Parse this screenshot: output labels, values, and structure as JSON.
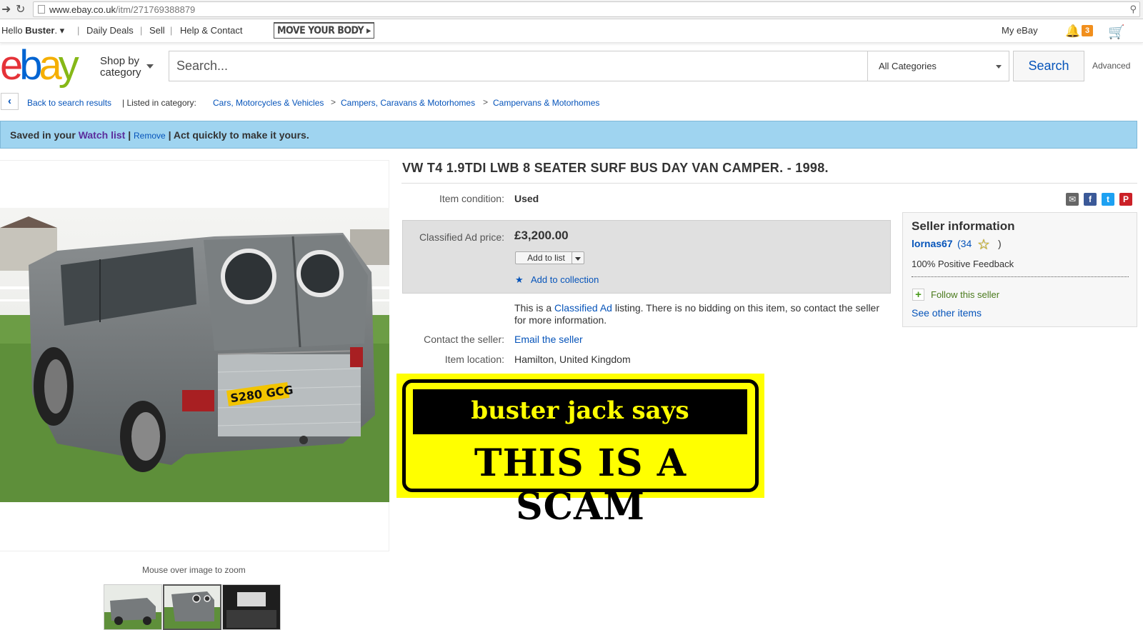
{
  "browser": {
    "url_host": "www.ebay.co.uk",
    "url_path": "/itm/271769388879"
  },
  "topnav": {
    "hello": "Hello",
    "user": "Buster",
    "daily_deals": "Daily Deals",
    "sell": "Sell",
    "help": "Help & Contact",
    "promo": "MOVE YOUR BODY ▸",
    "my_ebay": "My eBay",
    "notifications": "3"
  },
  "header": {
    "shop_by": "Shop by",
    "category": "category",
    "search_placeholder": "Search...",
    "category_select": "All Categories",
    "search_button": "Search",
    "advanced": "Advanced"
  },
  "breadcrumb": {
    "back": "Back to search results",
    "listed_in": "| Listed in category:",
    "items": [
      "Cars, Motorcycles & Vehicles",
      "Campers, Caravans & Motorhomes",
      "Campervans & Motorhomes"
    ],
    "sep": ">"
  },
  "saved_banner": {
    "saved_in": "Saved in your",
    "watch_list": "Watch list",
    "remove": "Remove",
    "act": "| Act quickly to make it yours."
  },
  "listing": {
    "title": "VW T4 1.9TDI LWB 8 SEATER SURF BUS DAY VAN CAMPER. - 1998.",
    "condition_label": "Item condition:",
    "condition": "Used",
    "price_label": "Classified Ad price:",
    "price": "£3,200.00",
    "add_to_list": "Add to list",
    "add_to_collection": "Add to collection",
    "desc_pre": "This is a",
    "desc_link": "Classified Ad",
    "desc_post": "listing. There is no bidding on this item, so contact the seller for more information.",
    "contact_label": "Contact the seller:",
    "contact": "Email the seller",
    "location_label": "Item location:",
    "location": "Hamilton, United Kingdom",
    "zoom_hint": "Mouse over image to zoom",
    "plate": "S280 GCG"
  },
  "scam_sticker": {
    "top": "buster jack says",
    "bottom": "THIS IS A SCAM"
  },
  "seller": {
    "heading": "Seller information",
    "name": "lornas67",
    "score": "(34",
    "paren_close": ")",
    "feedback": "100% Positive Feedback",
    "follow": "Follow this seller",
    "see_other": "See other items"
  },
  "colors": {
    "ebay_red": "#e53238",
    "ebay_blue": "#0064d2",
    "ebay_yellow": "#f5af02",
    "ebay_green": "#86b817",
    "link_blue": "#0654ba",
    "banner_blue": "#9fd4f0",
    "scam_yellow": "#ffff00"
  }
}
